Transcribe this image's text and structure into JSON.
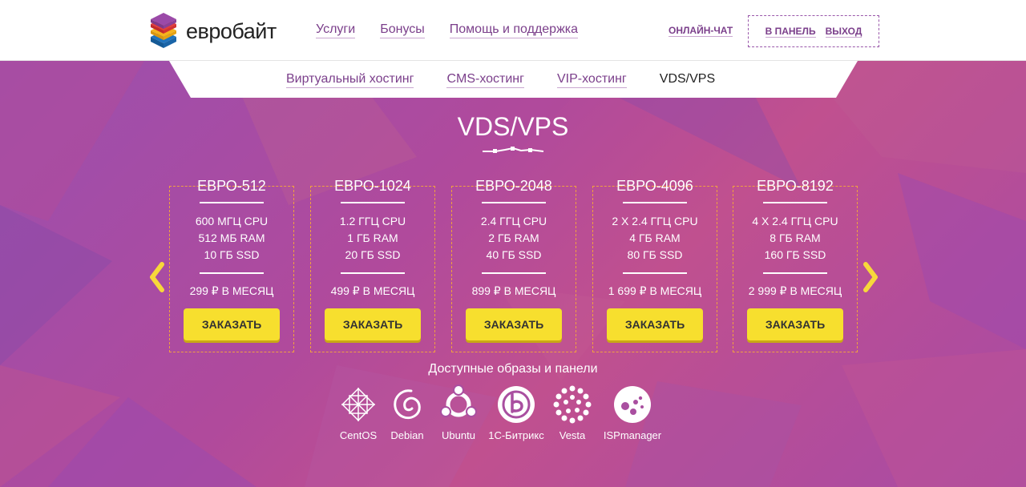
{
  "header": {
    "logo_text": "евробайт",
    "nav": [
      "Услуги",
      "Бонусы",
      "Помощь и поддержка"
    ],
    "chat": "ОНЛАЙН-ЧАТ",
    "panel": "В ПАНЕЛЬ",
    "logout": "ВЫХОД"
  },
  "subnav": {
    "items": [
      "Виртуальный хостинг",
      "CMS-хостинг",
      "VIP-хостинг"
    ],
    "active": "VDS/VPS"
  },
  "page_title": "VDS/VPS",
  "plans": [
    {
      "name": "ЕВРО-512",
      "cpu": "600 МГЦ CPU",
      "ram": "512 МБ RAM",
      "ssd": "10 ГБ SSD",
      "price": "299 ₽ В МЕСЯЦ",
      "button": "ЗАКАЗАТЬ"
    },
    {
      "name": "ЕВРО-1024",
      "cpu": "1.2 ГГЦ CPU",
      "ram": "1 ГБ RAM",
      "ssd": "20 ГБ SSD",
      "price": "499 ₽ В МЕСЯЦ",
      "button": "ЗАКАЗАТЬ"
    },
    {
      "name": "ЕВРО-2048",
      "cpu": "2.4 ГГЦ CPU",
      "ram": "2 ГБ RAM",
      "ssd": "40 ГБ SSD",
      "price": "899 ₽ В МЕСЯЦ",
      "button": "ЗАКАЗАТЬ"
    },
    {
      "name": "ЕВРО-4096",
      "cpu": "2 X 2.4 ГГЦ CPU",
      "ram": "4 ГБ RAM",
      "ssd": "80 ГБ SSD",
      "price": "1 699 ₽ В МЕСЯЦ",
      "button": "ЗАКАЗАТЬ"
    },
    {
      "name": "ЕВРО-8192",
      "cpu": "4 X 2.4 ГГЦ CPU",
      "ram": "8 ГБ RAM",
      "ssd": "160 ГБ SSD",
      "price": "2 999 ₽ В МЕСЯЦ",
      "button": "ЗАКАЗАТЬ"
    }
  ],
  "images_title": "Доступные образы и панели",
  "images": [
    {
      "label": "CentOS",
      "icon": "centos-icon"
    },
    {
      "label": "Debian",
      "icon": "debian-icon"
    },
    {
      "label": "Ubuntu",
      "icon": "ubuntu-icon"
    },
    {
      "label": "1С-Битрикс",
      "icon": "bitrix-icon"
    },
    {
      "label": "Vesta",
      "icon": "vesta-icon"
    },
    {
      "label": "ISPmanager",
      "icon": "ispmanager-icon"
    }
  ],
  "colors": {
    "accent": "#7b3f8b",
    "button": "#f7df2e",
    "arrow": "#f7d83a",
    "plan_border": "#f0a040"
  }
}
